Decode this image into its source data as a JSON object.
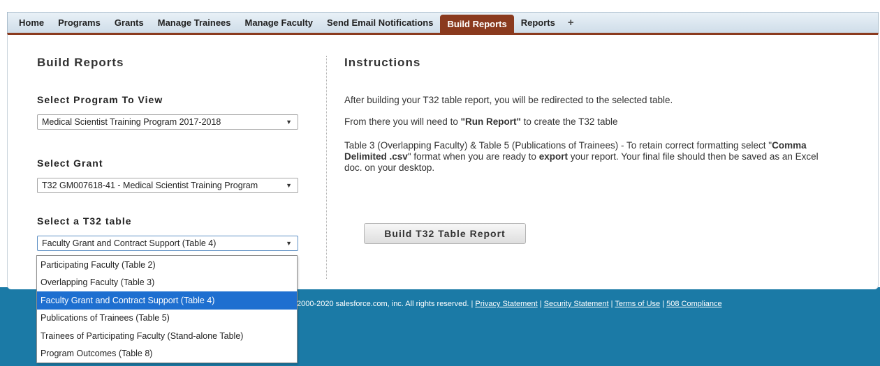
{
  "nav": {
    "tabs": [
      {
        "label": "Home"
      },
      {
        "label": "Programs"
      },
      {
        "label": "Grants"
      },
      {
        "label": "Manage Trainees"
      },
      {
        "label": "Manage Faculty"
      },
      {
        "label": "Send Email Notifications"
      },
      {
        "label": "Build Reports",
        "active": true
      },
      {
        "label": "Reports"
      }
    ],
    "plus": "+"
  },
  "build": {
    "title": "Build Reports",
    "program": {
      "label": "Select Program To View",
      "value": "Medical Scientist Training Program 2017-2018"
    },
    "grant": {
      "label": "Select Grant",
      "value": "T32 GM007618-41 - Medical Scientist Training Program"
    },
    "table": {
      "label": "Select a T32 table",
      "value": "Faculty Grant and Contract Support (Table 4)",
      "options": [
        "Participating Faculty (Table 2)",
        "Overlapping Faculty (Table 3)",
        "Faculty Grant and Contract Support (Table 4)",
        "Publications of Trainees (Table 5)",
        "Trainees of Participating Faculty (Stand-alone Table)",
        "Program Outcomes (Table 8)"
      ],
      "selected_index": 2
    }
  },
  "instructions": {
    "title": "Instructions",
    "p1": "After building your T32 table report, you will be redirected to the selected table.",
    "p2_pre": "From there you will need to ",
    "p2_bold": "\"Run Report\"",
    "p2_post": " to create the T32 table",
    "p3_a": "Table 3 (Overlapping Faculty) & Table 5 (Publications of Trainees) - To retain correct formatting select \"",
    "p3_b": "Comma Delimited .csv",
    "p3_c": "\" format when you are ready to ",
    "p3_d": "export",
    "p3_e": " your report. Your final file should then be saved as an Excel doc. on your desktop.",
    "button": "Build T32 Table Report"
  },
  "footer": {
    "copyright": "2000-2020 salesforce.com, inc. All rights reserved. |",
    "sep": "|",
    "links": [
      "Privacy Statement",
      "Security Statement",
      "Terms of Use",
      "508 Compliance"
    ]
  },
  "colors": {
    "active_tab": "#8a3a1e",
    "footer_bg": "#1b7aa6",
    "dropdown_highlight": "#1e6fd0"
  }
}
